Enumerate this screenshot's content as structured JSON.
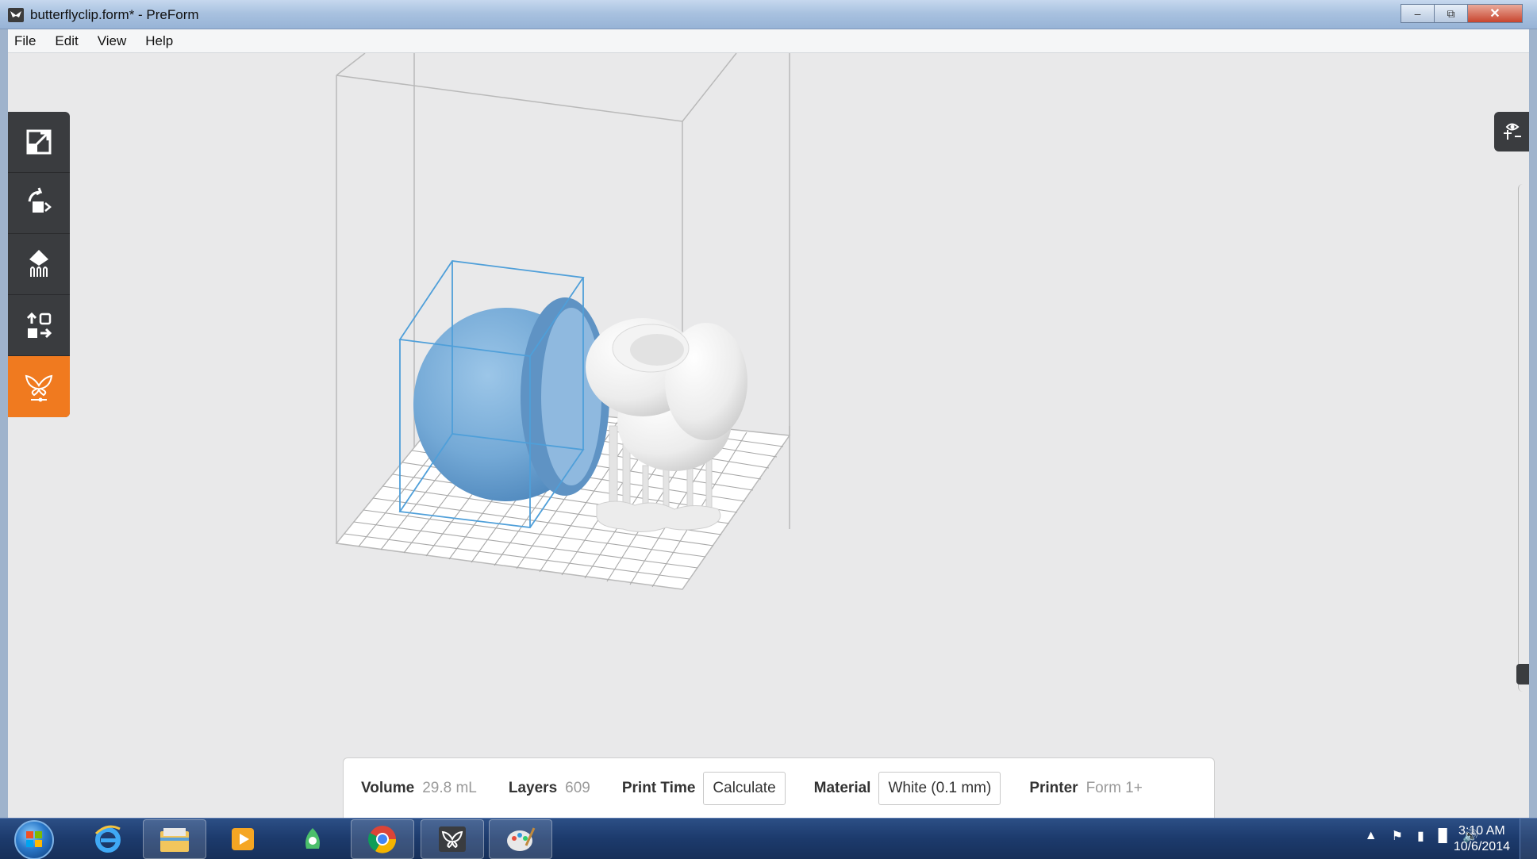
{
  "window": {
    "title": "butterflyclip.form* - PreForm",
    "minimize_icon": "minimize-icon",
    "maximize_icon": "maximize-icon",
    "close_icon": "close-icon"
  },
  "menu": [
    "File",
    "Edit",
    "View",
    "Help"
  ],
  "toolbar": {
    "tools": [
      {
        "icon": "scale-icon",
        "active": false
      },
      {
        "icon": "rotate-icon",
        "active": false
      },
      {
        "icon": "supports-icon",
        "active": false
      },
      {
        "icon": "layout-icon",
        "active": false
      },
      {
        "icon": "print-butterfly-icon",
        "active": true
      }
    ],
    "accent": "#f07a1f",
    "background": "#3a3c3f"
  },
  "view_panel": {
    "icon": "view-eye-icon"
  },
  "info": {
    "volume_label": "Volume",
    "volume_value": "29.8 mL",
    "layers_label": "Layers",
    "layers_value": "609",
    "print_time_label": "Print Time",
    "calculate_button": "Calculate",
    "material_label": "Material",
    "material_value": "White (0.1 mm)",
    "printer_label": "Printer",
    "printer_value": "Form 1+"
  },
  "scene": {
    "selected_model_color": "#7aaed8",
    "model_color": "#f4f4f4",
    "build_volume_color": "#b9b9b9"
  },
  "taskbar": {
    "apps": [
      "internet-explorer-icon",
      "file-explorer-icon",
      "media-player-icon",
      "utility-app-icon",
      "chrome-icon",
      "preform-icon",
      "paint-icon"
    ],
    "tray_icons": [
      "show-hidden-icons-icon",
      "action-center-flag-icon",
      "power-icon",
      "network-signal-icon",
      "volume-icon"
    ],
    "time": "3:10 AM",
    "date": "10/6/2014"
  }
}
